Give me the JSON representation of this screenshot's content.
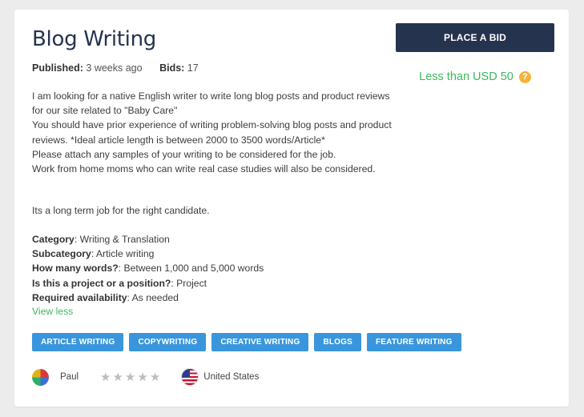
{
  "job": {
    "title": "Blog Writing",
    "published_label": "Published:",
    "published_value": "3 weeks ago",
    "bids_label": "Bids:",
    "bids_value": "17",
    "place_bid_label": "PLACE A BID",
    "budget": "Less than USD 50",
    "help_symbol": "?",
    "description": [
      "I am looking for a native English writer to write long blog posts and product reviews for our site related to \"Baby Care\"",
      "You should have prior experience of writing problem-solving blog posts and product reviews. *Ideal article length is between 2000 to 3500 words/Article*",
      "Please attach any samples of your writing to be considered for the job.",
      "Work from home moms who can write real case studies will also be considered."
    ],
    "long_term": "Its a long term job for the right candidate.",
    "details": [
      {
        "label": "Category",
        "value": ": Writing & Translation"
      },
      {
        "label": "Subcategory",
        "value": ": Article writing"
      },
      {
        "label": "How many words?",
        "value": ": Between 1,000 and 5,000 words"
      },
      {
        "label": "Is this a project or a position?",
        "value": ": Project"
      },
      {
        "label": "Required availability",
        "value": ": As needed"
      }
    ],
    "view_less": "View less",
    "tags": [
      "ARTICLE WRITING",
      "COPYWRITING",
      "CREATIVE WRITING",
      "BLOGS",
      "FEATURE WRITING"
    ]
  },
  "poster": {
    "name": "Paul",
    "stars": "★★★★★",
    "rating": 0,
    "country": "United States"
  },
  "colors": {
    "accent": "#26334f",
    "green": "#3cb85c",
    "tag_blue": "#3a96dc"
  }
}
